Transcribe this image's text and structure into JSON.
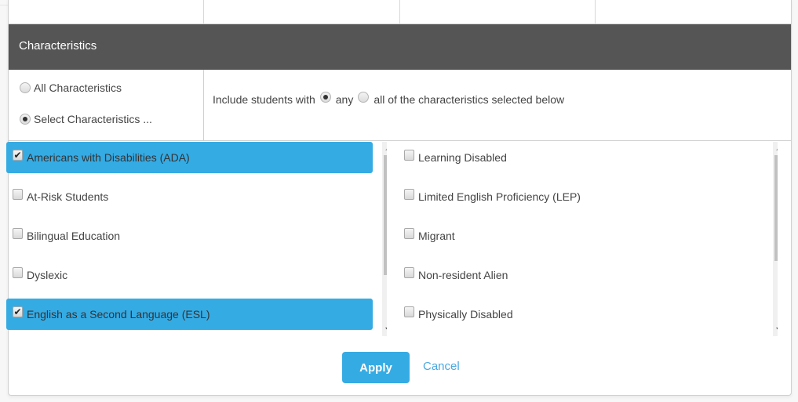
{
  "section": {
    "title": "Characteristics"
  },
  "scope_options": [
    {
      "label": "All Characteristics",
      "checked": false
    },
    {
      "label": "Select Characteristics ...",
      "checked": true
    }
  ],
  "match_mode": {
    "prefix": "Include students with",
    "options": [
      {
        "label": "any",
        "checked": true
      },
      {
        "label": "all of the characteristics selected below",
        "checked": false
      }
    ]
  },
  "characteristics_left": [
    {
      "label": "Americans with Disabilities (ADA)",
      "checked": true
    },
    {
      "label": "At-Risk Students",
      "checked": false
    },
    {
      "label": "Bilingual Education",
      "checked": false
    },
    {
      "label": "Dyslexic",
      "checked": false
    },
    {
      "label": "English as a Second Language (ESL)",
      "checked": true
    }
  ],
  "characteristics_right": [
    {
      "label": "Learning Disabled",
      "checked": false
    },
    {
      "label": "Limited English Proficiency (LEP)",
      "checked": false
    },
    {
      "label": "Migrant",
      "checked": false
    },
    {
      "label": "Non-resident Alien",
      "checked": false
    },
    {
      "label": "Physically Disabled",
      "checked": false
    }
  ],
  "actions": {
    "apply_label": "Apply",
    "cancel_label": "Cancel"
  },
  "colors": {
    "accent": "#35abe4",
    "header_bg": "#555555",
    "link": "#4aa8e0"
  }
}
